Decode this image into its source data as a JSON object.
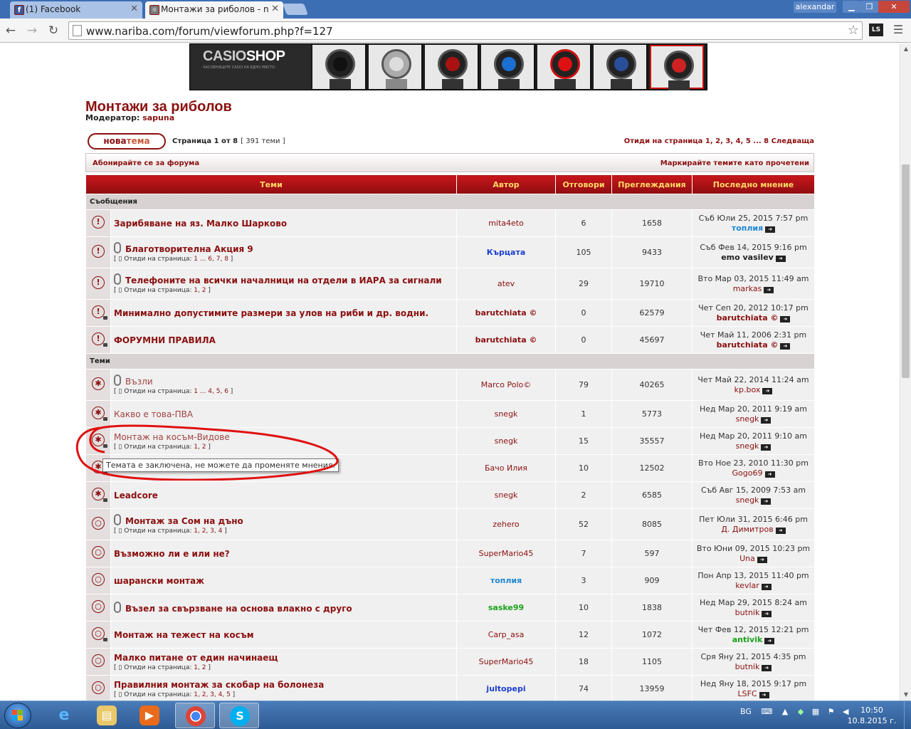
{
  "browser": {
    "tabs": [
      {
        "label": "(1) Facebook",
        "active": false,
        "icon": "facebook-icon"
      },
      {
        "label": "Монтажи за риболов - n",
        "active": true,
        "icon": "forum-favicon"
      }
    ],
    "profile": "alexandar",
    "url": "www.nariba.com/forum/viewforum.php?f=127",
    "ext_label": "LS"
  },
  "banner": {
    "brand_a": "CASIO",
    "brand_b": "SHOP",
    "tagline": "ЧАСОВНИЦИТЕ CASIO НА ЕДНО МЯСТО"
  },
  "forum": {
    "title": "Монтажи за риболов",
    "moderator_label": "Модератор:",
    "moderator_name": "sapuna",
    "new_topic_a": "нова",
    "new_topic_b": "тема",
    "page_info": "Страница 1 от 8",
    "topic_count": "[ 391 теми ]",
    "pagination": "Отиди на страница 1, 2, 3, 4, 5 ... 8  Следваща",
    "subscribe": "Абонирайте се за форума",
    "mark_read": "Маркирайте темите като прочетени"
  },
  "table": {
    "headers": [
      "Теми",
      "Автор",
      "Отговори",
      "Преглеждания",
      "Последно мнение"
    ],
    "section_announcements": "Съобщения",
    "section_topics": "Теми",
    "rows": [
      {
        "section": "a",
        "title": "Зарибяване на яз. Малко Шарково",
        "attach": false,
        "pages": "",
        "author": "mita4eto",
        "author_color": "#8b1010",
        "author_bold": false,
        "replies": "6",
        "views": "1658",
        "last_date": "Съб Юли 25, 2015 7:57 pm",
        "last_user": "топлия",
        "last_user_color": "#1e88d4",
        "icon": "announce",
        "title_style": "bold"
      },
      {
        "section": "a",
        "title": "Благотворителна Акция 9",
        "attach": true,
        "pages": "1 ... 6, 7, 8",
        "author": "Кърцата",
        "author_color": "#1a3fd0",
        "author_bold": true,
        "replies": "105",
        "views": "9433",
        "last_date": "Съб Фев 14, 2015 9:16 pm",
        "last_user": "emo vasilev",
        "last_user_color": "#222222",
        "icon": "announce",
        "title_style": "bold"
      },
      {
        "section": "a",
        "title": "Телефоните на всички началници на отдели в ИАРА за сигнали",
        "attach": true,
        "pages": "1, 2",
        "author": "atev",
        "author_color": "#8b1010",
        "author_bold": false,
        "replies": "29",
        "views": "19710",
        "last_date": "Вто Мар 03, 2015 11:49 am",
        "last_user": "markas",
        "last_user_color": "#8b1010",
        "icon": "announce",
        "title_style": "bold"
      },
      {
        "section": "a",
        "title": "Минимално допустимите размери за улов на риби и др. водни.",
        "attach": false,
        "pages": "",
        "author": "barutchiata ©",
        "author_color": "#8b1010",
        "author_bold": true,
        "replies": "0",
        "views": "62579",
        "last_date": "Чет Сеп 20, 2012 10:17 pm",
        "last_user": "barutchiata ©",
        "last_user_color": "#8b1010",
        "icon": "announce-lock",
        "title_style": "bold"
      },
      {
        "section": "a",
        "title": "ФОРУМНИ ПРАВИЛА",
        "attach": false,
        "pages": "",
        "author": "barutchiata ©",
        "author_color": "#8b1010",
        "author_bold": true,
        "replies": "0",
        "views": "45697",
        "last_date": "Чет Май 11, 2006 2:31 pm",
        "last_user": "barutchiata ©",
        "last_user_color": "#8b1010",
        "icon": "announce-lock",
        "title_style": "bold"
      },
      {
        "section": "t",
        "title": "Възли",
        "attach": true,
        "pages": "1 ... 4, 5, 6",
        "author": "Marco Polo©",
        "author_color": "#8b1010",
        "author_bold": false,
        "replies": "79",
        "views": "40265",
        "last_date": "Чет Май 22, 2014 11:24 am",
        "last_user": "kp.box",
        "last_user_color": "#8b1010",
        "icon": "sticky",
        "title_style": "muted"
      },
      {
        "section": "t",
        "title": "Какво е това-ПВА",
        "attach": false,
        "pages": "",
        "author": "snegk",
        "author_color": "#8b1010",
        "author_bold": false,
        "replies": "1",
        "views": "5773",
        "last_date": "Нед Мар 20, 2011 9:19 am",
        "last_user": "snegk",
        "last_user_color": "#8b1010",
        "icon": "sticky-lock",
        "title_style": "muted"
      },
      {
        "section": "t",
        "title": "Монтаж на косъм-Видове",
        "attach": false,
        "pages": "1, 2",
        "author": "snegk",
        "author_color": "#8b1010",
        "author_bold": false,
        "replies": "15",
        "views": "35557",
        "last_date": "Нед Мар 20, 2011 9:10 am",
        "last_user": "snegk",
        "last_user_color": "#8b1010",
        "icon": "sticky-lock",
        "title_style": "muted"
      },
      {
        "section": "t",
        "title": "",
        "attach": false,
        "pages": "",
        "author": "Бачо Илия",
        "author_color": "#8b1010",
        "author_bold": false,
        "replies": "10",
        "views": "12502",
        "last_date": "Вто Ное 23, 2010 11:30 pm",
        "last_user": "Gogo69",
        "last_user_color": "#8b1010",
        "icon": "sticky-lock",
        "title_style": "muted"
      },
      {
        "section": "t",
        "title": "Leadcore",
        "attach": false,
        "pages": "",
        "author": "snegk",
        "author_color": "#8b1010",
        "author_bold": false,
        "replies": "2",
        "views": "6585",
        "last_date": "Съб Авг 15, 2009 7:53 am",
        "last_user": "snegk",
        "last_user_color": "#8b1010",
        "icon": "sticky-lock",
        "title_style": "bold"
      },
      {
        "section": "t",
        "title": "Монтаж за Сом на дъно",
        "attach": true,
        "pages": "1, 2, 3, 4",
        "author": "zehero",
        "author_color": "#8b1010",
        "author_bold": false,
        "replies": "52",
        "views": "8085",
        "last_date": "Пет Юли 31, 2015 6:46 pm",
        "last_user": "Д. Димитров",
        "last_user_color": "#8b1010",
        "icon": "topic",
        "title_style": "bold"
      },
      {
        "section": "t",
        "title": "Възможно ли е или не?",
        "attach": false,
        "pages": "",
        "author": "SuperMario45",
        "author_color": "#8b1010",
        "author_bold": false,
        "replies": "7",
        "views": "597",
        "last_date": "Вто Юни 09, 2015 10:23 pm",
        "last_user": "Una",
        "last_user_color": "#8b1010",
        "icon": "topic",
        "title_style": "bold"
      },
      {
        "section": "t",
        "title": "шарански монтаж",
        "attach": false,
        "pages": "",
        "author": "топлия",
        "author_color": "#1e88d4",
        "author_bold": true,
        "replies": "3",
        "views": "909",
        "last_date": "Пон Апр 13, 2015 11:40 pm",
        "last_user": "kevlar",
        "last_user_color": "#8b1010",
        "icon": "topic",
        "title_style": "bold"
      },
      {
        "section": "t",
        "title": "Възел за свързване на основа влакно с друго",
        "attach": true,
        "pages": "",
        "author": "saske99",
        "author_color": "#19a319",
        "author_bold": true,
        "replies": "10",
        "views": "1838",
        "last_date": "Нед Мар 29, 2015 8:24 am",
        "last_user": "butnik",
        "last_user_color": "#8b1010",
        "icon": "topic",
        "title_style": "bold"
      },
      {
        "section": "t",
        "title": "Монтаж на тежест на косъм",
        "attach": false,
        "pages": "",
        "author": "Carp_asa",
        "author_color": "#8b1010",
        "author_bold": false,
        "replies": "12",
        "views": "1072",
        "last_date": "Чет Фев 12, 2015 12:21 pm",
        "last_user": "antivik",
        "last_user_color": "#19a319",
        "icon": "topic-lock",
        "title_style": "bold"
      },
      {
        "section": "t",
        "title": "Малко питане от един начинаещ",
        "attach": false,
        "pages": "1, 2",
        "author": "SuperMario45",
        "author_color": "#8b1010",
        "author_bold": false,
        "replies": "18",
        "views": "1105",
        "last_date": "Сря Яну 21, 2015 4:35 pm",
        "last_user": "butnik",
        "last_user_color": "#8b1010",
        "icon": "topic",
        "title_style": "bold"
      },
      {
        "section": "t",
        "title": "Правилния монтаж за скобар на болонеза",
        "attach": false,
        "pages": "1, 2, 3, 4, 5",
        "author": "jultopepi",
        "author_color": "#1a3fd0",
        "author_bold": true,
        "replies": "74",
        "views": "13959",
        "last_date": "Нед Яну 18, 2015 9:17 pm",
        "last_user": "LSFC",
        "last_user_color": "#8b1010",
        "icon": "topic",
        "title_style": "bold"
      }
    ],
    "pages_prefix": "Отиди на страница:",
    "tooltip": "Темата е заключена, не можете да променяте мнения."
  },
  "taskbar": {
    "lang": "BG",
    "time": "10:50",
    "date": "10.8.2015 г.",
    "apps": [
      "ie-icon",
      "explorer-icon",
      "media-player-icon",
      "chrome-icon",
      "skype-icon"
    ]
  },
  "colors": {
    "accent": "#8b1010",
    "header_gold": "#ffd966",
    "annotation": "#e01010"
  }
}
